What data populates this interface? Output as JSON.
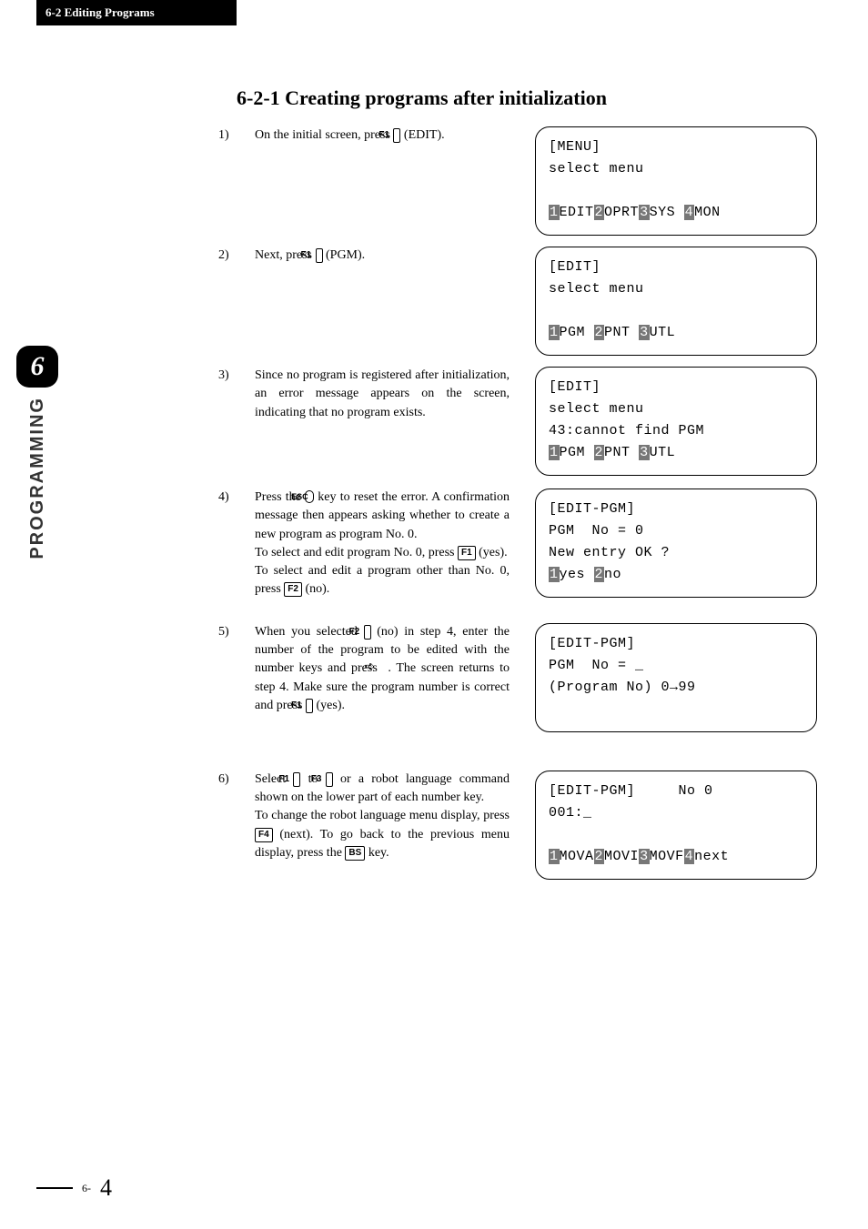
{
  "header": "6-2 Editing Programs",
  "title": "6-2-1  Creating programs after initialization",
  "side": {
    "chapter": "6",
    "label": "PROGRAMMING"
  },
  "footer": {
    "prefix": "6-",
    "page": "4"
  },
  "keys": {
    "F1": "F1",
    "F2": "F2",
    "F3": "F3",
    "F4": "F4",
    "ESC": "ESC",
    "BS": "BS"
  },
  "steps": [
    {
      "num": "1)",
      "pre": "On the initial screen, press ",
      "key": "F1",
      "post": " (EDIT)."
    },
    {
      "num": "2)",
      "pre": "Next, press ",
      "key": "F1",
      "post": " (PGM)."
    },
    {
      "num": "3)",
      "body": "Since no program is registered after initialization, an error message appears on the screen, indicating that no program exists."
    },
    {
      "num": "4)",
      "p1_pre": "Press the ",
      "p1_key": "ESC",
      "p1_post": " key to reset the error. A confirmation message then appears asking whether to create a new program as program No. 0.",
      "p2_pre": "To select and edit program No. 0, press ",
      "p2_key": "F1",
      "p2_post": " (yes).",
      "p3_pre": "To select and edit a program other than No. 0, press ",
      "p3_key": "F2",
      "p3_post": " (no)."
    },
    {
      "num": "5)",
      "p1_pre": "When you selected ",
      "p1_key": "F2",
      "p1_mid": " (no) in step 4, enter the number of the program to be edited with the number keys and press ",
      "p1_icon": "enter-arrow",
      "p1_post": " . The screen returns to step 4. Make sure the program number is correct and press ",
      "p1_key2": "F1",
      "p1_tail": " (yes)."
    },
    {
      "num": "6)",
      "p1_pre": "Select ",
      "p1_k1": "F1",
      "p1_mid1": " to ",
      "p1_k2": "F3",
      "p1_post": " or a robot language command shown on the lower part of each number key.",
      "p2_pre": "To change the robot language menu display, press ",
      "p2_key": "F4",
      "p2_mid": " (next). To go back to the previous menu display, press the ",
      "p2_key2": "BS",
      "p2_post": " key."
    }
  ],
  "screens": [
    {
      "lines": [
        {
          "t": "[MENU]"
        },
        {
          "t": "select menu"
        },
        {
          "t": " "
        },
        {
          "seg": [
            {
              "i": "1"
            },
            "EDIT",
            {
              "i": "2"
            },
            "OPRT",
            {
              "i": "3"
            },
            "SYS ",
            {
              "i": "4"
            },
            "MON"
          ]
        }
      ]
    },
    {
      "lines": [
        {
          "t": "[EDIT]"
        },
        {
          "t": "select menu"
        },
        {
          "t": " "
        },
        {
          "seg": [
            {
              "i": "1"
            },
            "PGM ",
            {
              "i": "2"
            },
            "PNT ",
            {
              "i": "3"
            },
            "UTL"
          ]
        }
      ]
    },
    {
      "lines": [
        {
          "t": "[EDIT]"
        },
        {
          "t": "select menu"
        },
        {
          "t": "43:cannot find PGM"
        },
        {
          "seg": [
            {
              "i": "1"
            },
            "PGM ",
            {
              "i": "2"
            },
            "PNT ",
            {
              "i": "3"
            },
            "UTL"
          ]
        }
      ]
    },
    {
      "lines": [
        {
          "t": "[EDIT-PGM]"
        },
        {
          "t": "PGM  No = 0"
        },
        {
          "t": "New entry OK ?"
        },
        {
          "seg": [
            {
              "i": "1"
            },
            "yes ",
            {
              "i": "2"
            },
            "no"
          ]
        }
      ]
    },
    {
      "lines": [
        {
          "t": "[EDIT-PGM]"
        },
        {
          "t": "PGM  No = _"
        },
        {
          "t": "(Program No) 0→99"
        },
        {
          "t": " "
        }
      ]
    },
    {
      "lines": [
        {
          "seg": [
            "[EDIT-PGM]     No 0"
          ]
        },
        {
          "t": "001:_"
        },
        {
          "t": " "
        },
        {
          "seg": [
            {
              "i": "1"
            },
            "MOVA",
            {
              "i": "2"
            },
            "MOVI",
            {
              "i": "3"
            },
            "MOVF",
            {
              "i": "4"
            },
            "next"
          ]
        }
      ]
    }
  ]
}
